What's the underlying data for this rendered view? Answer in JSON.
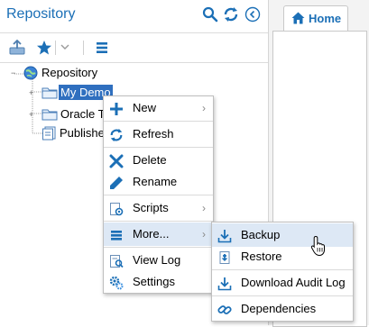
{
  "repository": {
    "title": "Repository",
    "tree": {
      "root": "Repository",
      "items": [
        "My Demo",
        "Oracle T",
        "Publishe"
      ]
    }
  },
  "tabs": {
    "home": "Home"
  },
  "context_menu": {
    "items": [
      {
        "label": "New",
        "submenu": true
      },
      {
        "label": "Refresh"
      },
      {
        "label": "Delete"
      },
      {
        "label": "Rename"
      },
      {
        "label": "Scripts",
        "submenu": true
      },
      {
        "label": "More...",
        "submenu": true
      },
      {
        "label": "View Log"
      },
      {
        "label": "Settings"
      }
    ]
  },
  "more_submenu": {
    "items": [
      {
        "label": "Backup"
      },
      {
        "label": "Restore"
      },
      {
        "label": "Download Audit Log"
      },
      {
        "label": "Dependencies"
      }
    ]
  },
  "colors": {
    "accent": "#1b6fb6",
    "selection": "#2f6fbf",
    "menu_highlight": "#dde8f5"
  }
}
